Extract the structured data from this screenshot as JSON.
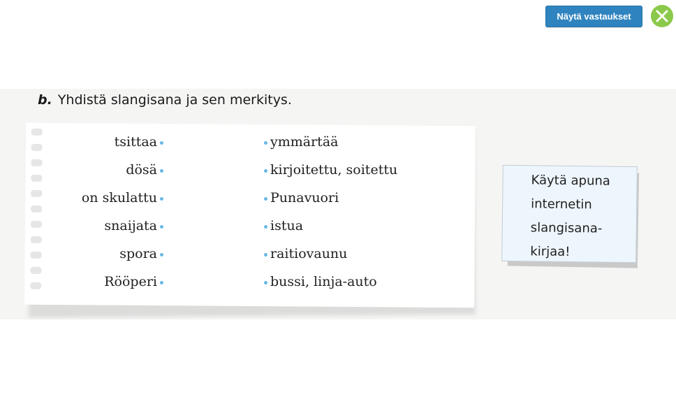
{
  "toolbar": {
    "show_answers_label": "Näytä vastaukset",
    "close_icon": "close-x-icon",
    "accent_color": "#2f84bf",
    "close_color": "#8bc94a"
  },
  "task": {
    "letter": "b.",
    "instruction": "Yhdistä slangisana ja sen merkitys."
  },
  "matching": {
    "dot_color": "#6ab8e4",
    "left": [
      "tsittaa",
      "dösä",
      "on skulattu",
      "snaijata",
      "spora",
      "Rööperi"
    ],
    "right": [
      "ymmärtää",
      "kirjoitettu, soitettu",
      "Punavuori",
      "istua",
      "raitiovaunu",
      "bussi, linja-auto"
    ]
  },
  "note": {
    "text_lines": [
      "Käytä apuna",
      "internetin",
      "slangisana-",
      "kirjaa!"
    ]
  }
}
